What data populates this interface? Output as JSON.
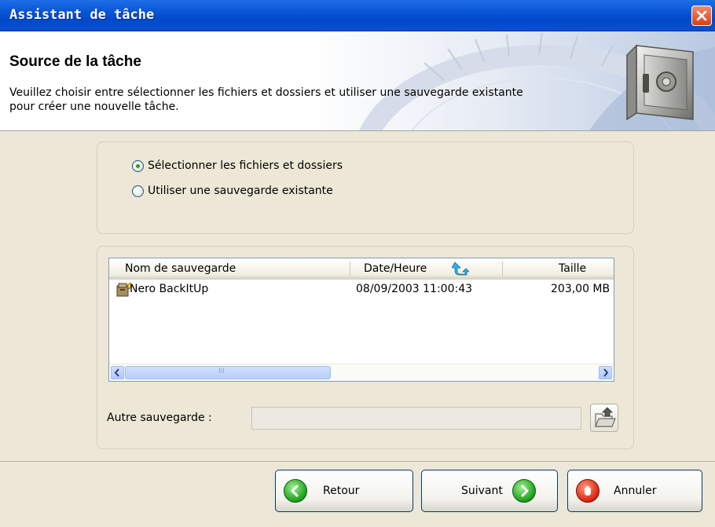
{
  "window": {
    "title": "Assistant de tâche",
    "close_icon": "close-icon"
  },
  "header": {
    "title": "Source de la tâche",
    "description": "Veuillez choisir entre sélectionner les fichiers et dossiers et utiliser une sauvegarde existante pour créer une nouvelle tâche.",
    "icon": "safe-icon"
  },
  "source_options": [
    {
      "label": "Sélectionner les fichiers et dossiers",
      "selected": true
    },
    {
      "label": "Utiliser une sauvegarde existante",
      "selected": false
    }
  ],
  "backup_list": {
    "columns": [
      "Nom de sauvegarde",
      "Date/Heure",
      "Taille"
    ],
    "sort_icon": "sort-arrow-icon",
    "rows": [
      {
        "name": "Nero BackItUp",
        "datetime": "08/09/2003 11:00:43",
        "size": "203,00 MB",
        "icon": "backup-file-icon"
      }
    ],
    "scrollbar_grip": "III"
  },
  "other_backup": {
    "label": "Autre sauvegarde :",
    "value": "",
    "browse_icon": "folder-open-icon"
  },
  "buttons": {
    "back": "Retour",
    "next": "Suivant",
    "cancel": "Annuler"
  },
  "colors": {
    "titlebar": "#0a58d8",
    "dialog_bg": "#ece7d6",
    "go_green": "#23a323",
    "stop_red": "#dd2b16"
  }
}
